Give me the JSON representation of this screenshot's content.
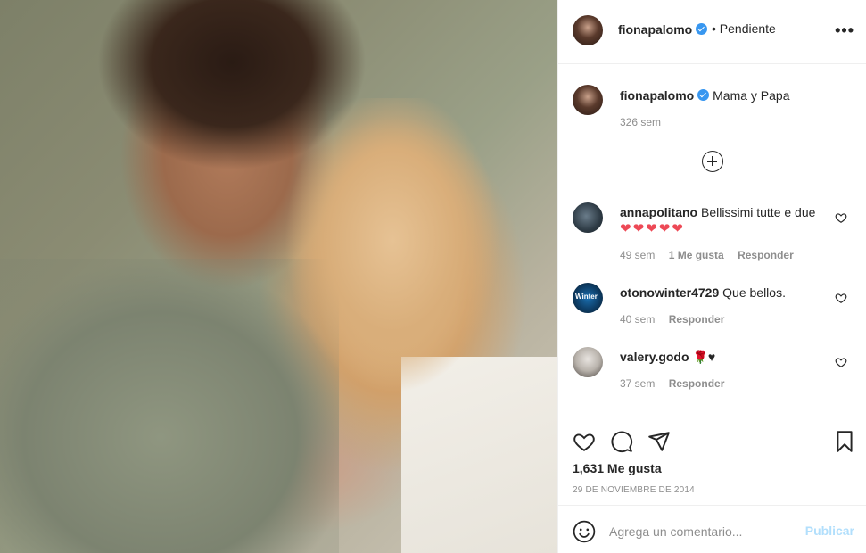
{
  "post": {
    "username": "fionapalomo",
    "status": "• Pendiente",
    "more_icon": "more-horizontal-icon",
    "caption": "Mama y Papa",
    "caption_time": "326 sem"
  },
  "comments": [
    {
      "username": "annapolitano",
      "text": "Bellissimi tutte e due",
      "emoji": "❤❤❤❤❤",
      "time": "49 sem",
      "likes": "1 Me gusta",
      "reply": "Responder"
    },
    {
      "username": "otonowinter4729",
      "text": "Que bellos.",
      "avatar_text": "Winter",
      "time": "40 sem",
      "reply": "Responder"
    },
    {
      "username": "valery.godo",
      "text": "🌹♥",
      "time": "37 sem",
      "reply": "Responder"
    }
  ],
  "actions": {
    "icons": [
      "heart-icon",
      "comment-icon",
      "share-icon",
      "bookmark-icon"
    ],
    "likes": "1,631 Me gusta",
    "date": "29 DE NOVIEMBRE DE 2014"
  },
  "add_comment": {
    "placeholder": "Agrega un comentario...",
    "publish": "Publicar"
  },
  "colors": {
    "link_blue": "#3897f0",
    "publish_disabled": "#b2dffc",
    "secondary_text": "#8e8e8e"
  }
}
